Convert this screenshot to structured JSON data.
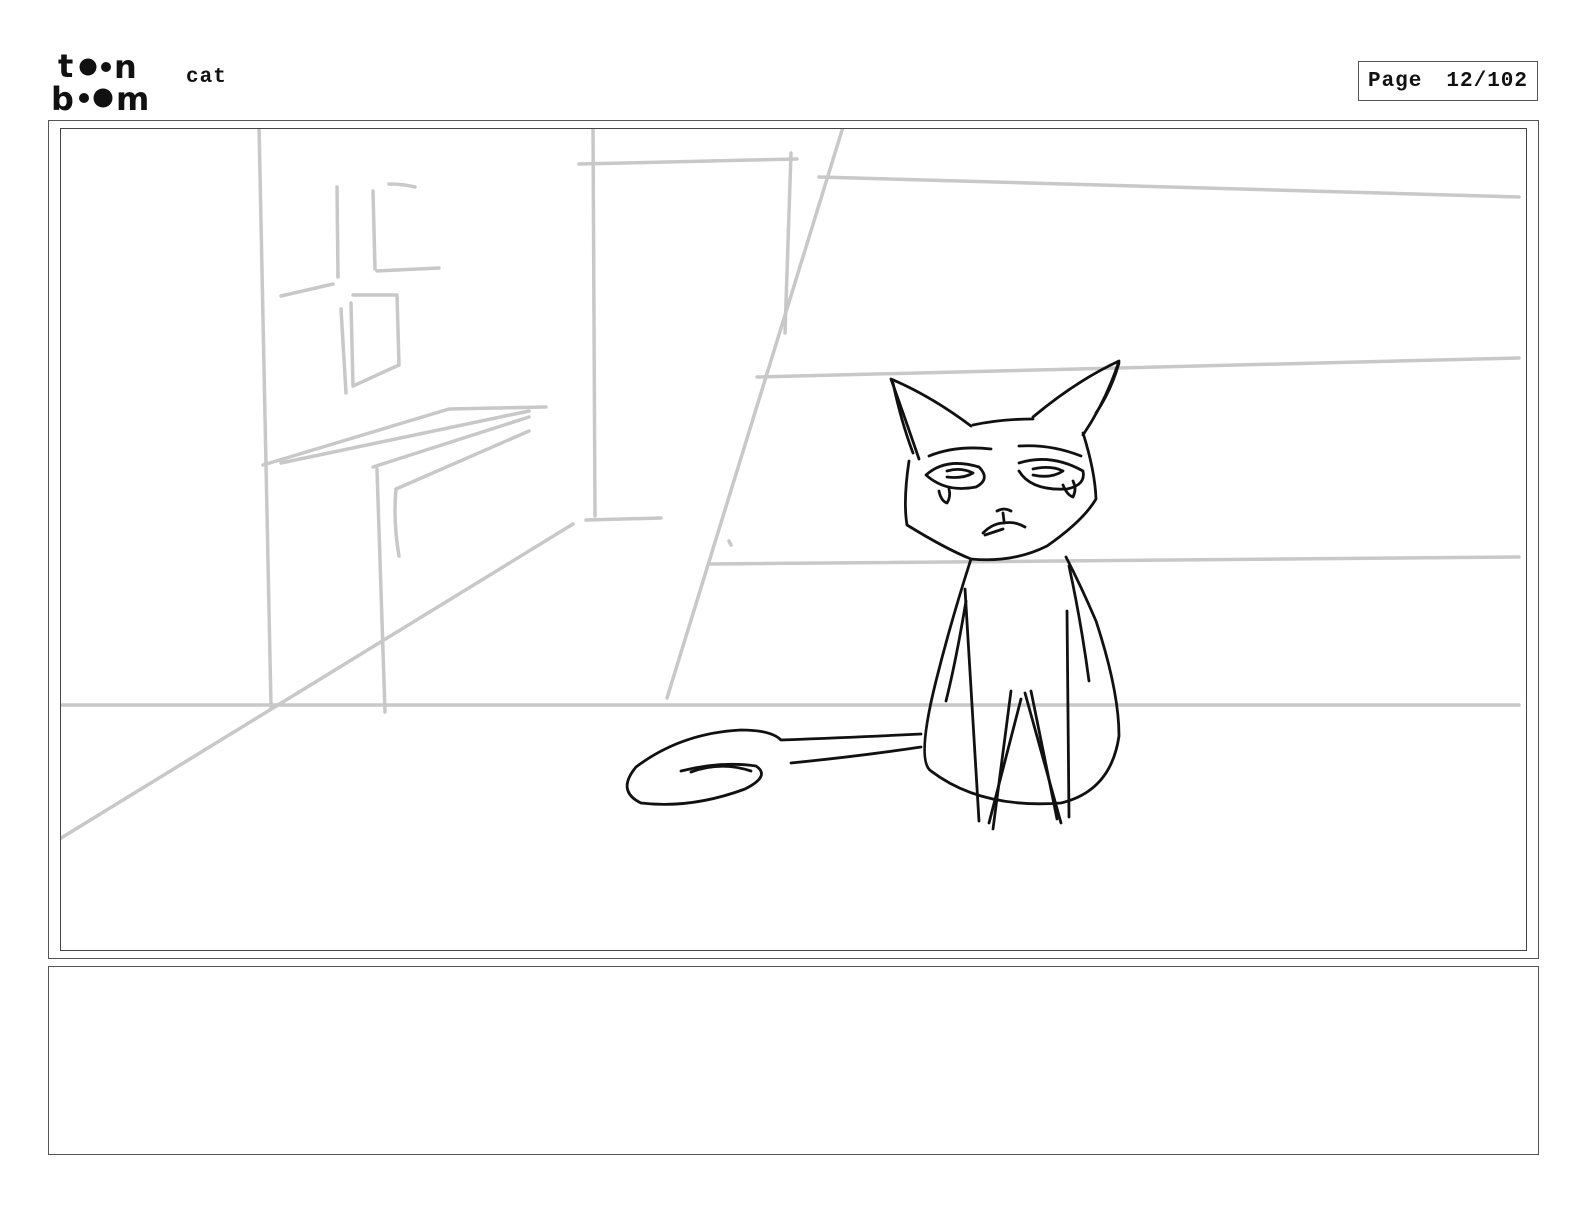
{
  "header": {
    "logo_text": "toon boom",
    "document_title": "cat",
    "page_label": "Page",
    "page_number": "12/102"
  },
  "panel": {
    "sketch_subject": "cat",
    "line_colors": {
      "background": "#c8c8c8",
      "character": "#111111"
    }
  },
  "notes": {
    "text": ""
  }
}
